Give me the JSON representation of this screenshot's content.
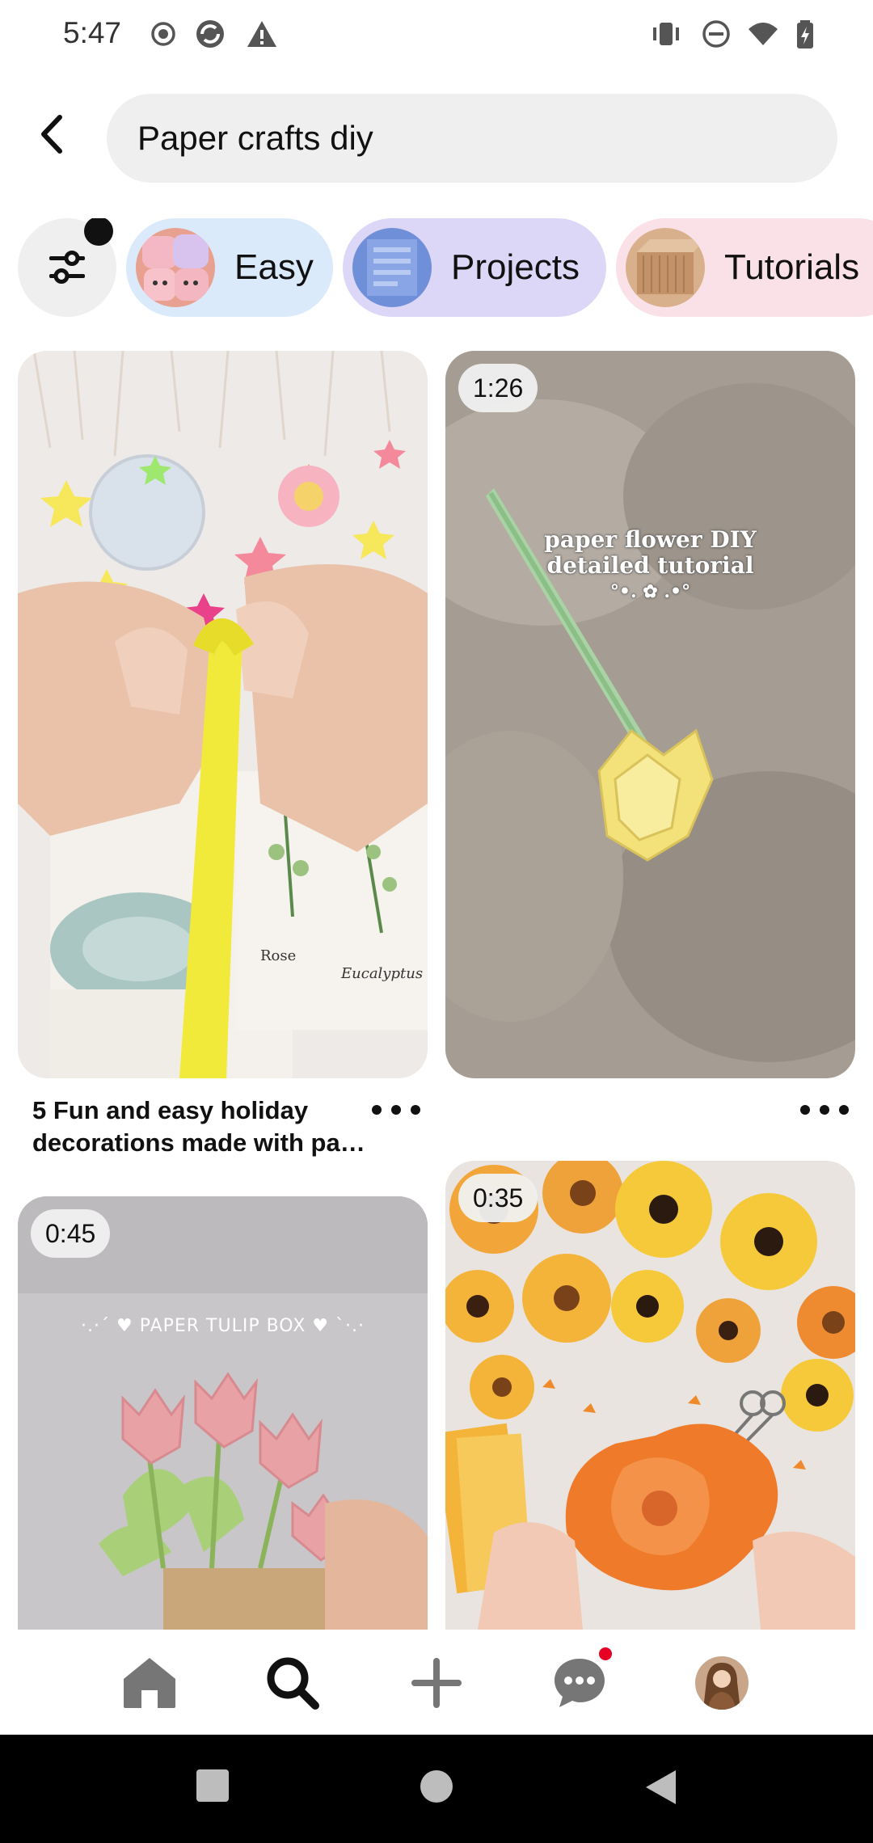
{
  "status_bar": {
    "time": "5:47",
    "left_icons": [
      "record-icon",
      "sync-icon",
      "warning-icon"
    ],
    "right_icons": [
      "vibrate-icon",
      "do-not-disturb-icon",
      "wifi-icon",
      "battery-icon"
    ]
  },
  "search": {
    "query": "Paper crafts diy",
    "back_icon": "chevron-left-icon"
  },
  "chips": {
    "filter_icon": "sliders-icon",
    "items": [
      {
        "label": "Easy",
        "color": "#dbeafa"
      },
      {
        "label": "Projects",
        "color": "#dcd6f7"
      },
      {
        "label": "Tutorials",
        "color": "#f9e1e7"
      }
    ]
  },
  "pins": [
    {
      "title_line1": "5 Fun and easy holiday",
      "title_line2": "decorations made with pa…",
      "duration": ""
    },
    {
      "duration": "1:26",
      "overlay_line1": "paper flower DIY",
      "overlay_line2": "detailed tutorial",
      "overlay_line3": "°•. ✿ .•°"
    },
    {
      "duration": "0:45",
      "overlay_text": "·.·´ ♥ PAPER TULIP BOX ♥ `·.·"
    },
    {
      "duration": "0:35"
    }
  ],
  "image_labels": {
    "rose": "Rose",
    "eucalyptus": "Eucalyptus"
  },
  "bottom_nav": {
    "items": [
      "home-icon",
      "search-icon",
      "plus-icon",
      "messages-icon",
      "profile-avatar"
    ],
    "active": "search-icon",
    "notification_color": "#e60023"
  },
  "system_nav": [
    "recents-icon",
    "home-circle-icon",
    "back-triangle-icon"
  ]
}
